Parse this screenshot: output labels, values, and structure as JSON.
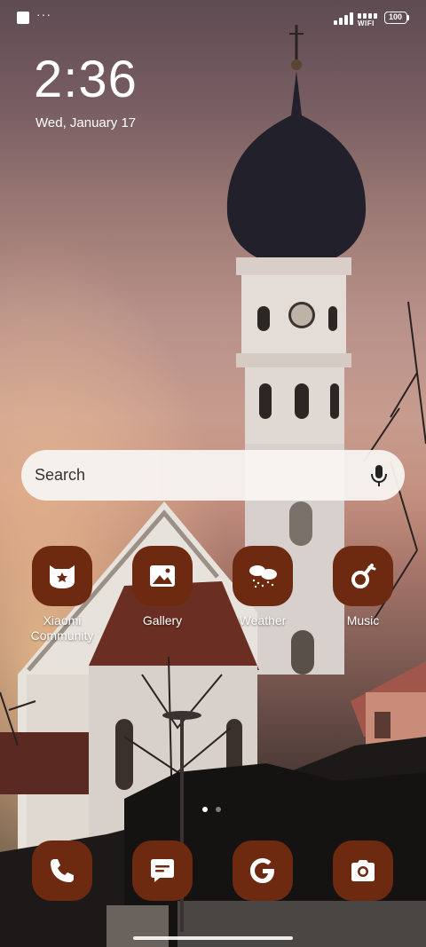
{
  "status_bar": {
    "more_indicator": "···",
    "wifi_label": "WIFI",
    "battery_level": "100"
  },
  "clock": {
    "time": "2:36",
    "date": "Wed, January 17"
  },
  "search": {
    "placeholder": "Search",
    "icon": "mic-icon"
  },
  "home_apps": [
    {
      "label": "Xiaomi Community",
      "label_lines": [
        "Xiaomi",
        "Community"
      ],
      "icon": "xiaomi-community-icon"
    },
    {
      "label": "Gallery",
      "icon": "gallery-icon"
    },
    {
      "label": "Weather",
      "icon": "weather-icon"
    },
    {
      "label": "Music",
      "icon": "music-icon"
    }
  ],
  "dock_apps": [
    {
      "name": "Phone",
      "icon": "phone-icon"
    },
    {
      "name": "Messages",
      "icon": "messages-icon"
    },
    {
      "name": "Google",
      "icon": "google-icon"
    },
    {
      "name": "Camera",
      "icon": "camera-icon"
    }
  ],
  "pager": {
    "pages": 2,
    "current": 1
  },
  "colors": {
    "icon_background": "#6e2a10",
    "search_background": "#f8f4f2",
    "text": "#ffffff"
  }
}
